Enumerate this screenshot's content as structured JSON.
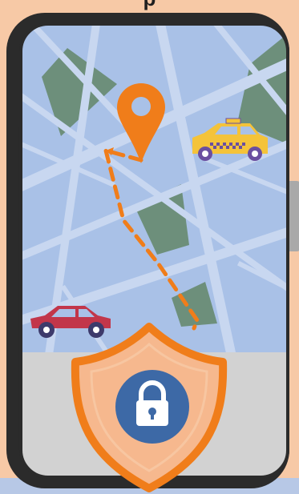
{
  "illustration": {
    "top_caption": "p",
    "icons": {
      "location_pin": "map-pin-icon",
      "taxi": "taxi-icon",
      "car": "red-car-icon",
      "shield": "shield-icon",
      "lock": "padlock-icon"
    },
    "colors": {
      "background_skin": "#f7c9a6",
      "phone_body": "#2b2b2b",
      "map_blue": "#a9c1e7",
      "map_roads": "#c8d7f0",
      "park_green": "#6d8f7b",
      "pin_orange": "#f07d1a",
      "route_orange": "#f07d1a",
      "taxi_yellow": "#f4c33a",
      "car_red": "#c2364a",
      "ground_gray": "#d2d2d2",
      "shield_orange": "#f07d1a",
      "shield_fill": "#f6b88e",
      "lock_blue": "#3d69a6",
      "bottom_band": "#b7c8e6"
    }
  }
}
